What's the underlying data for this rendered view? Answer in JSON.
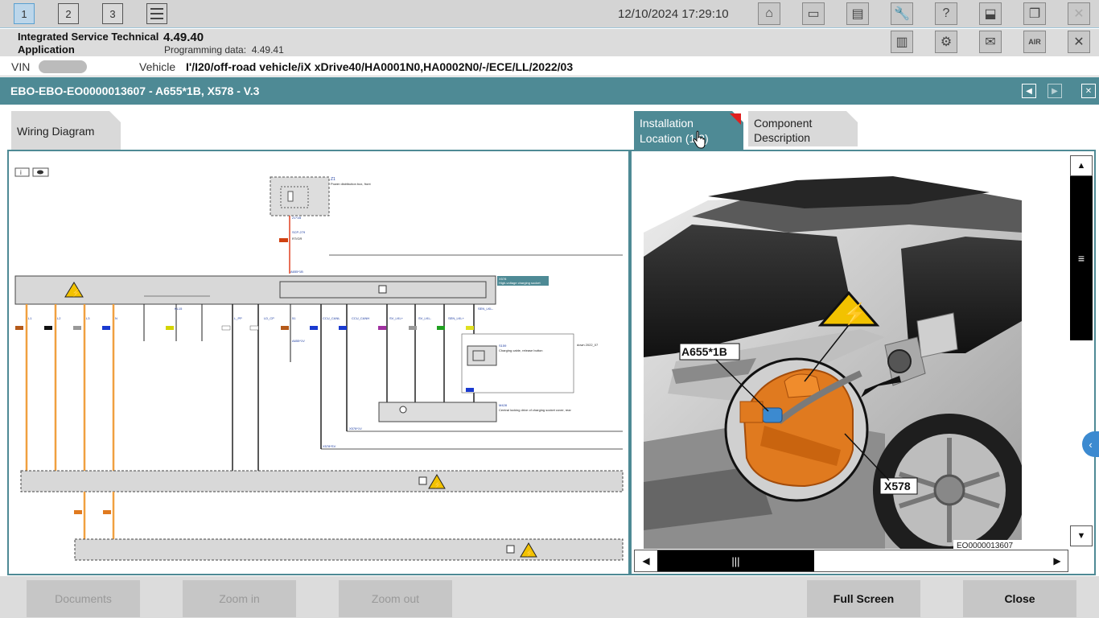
{
  "topbar": {
    "tabs": [
      "1",
      "2",
      "3"
    ],
    "datetime": "12/10/2024 17:29:10"
  },
  "app": {
    "name": "Integrated Service Technical Application",
    "version": "4.49.40",
    "programming_label": "Programming data:",
    "programming_version": "4.49.41"
  },
  "vehicle": {
    "vin_label": "VIN",
    "vin_value": "",
    "vehicle_label": "Vehicle",
    "vehicle_value": "I'/I20/off-road vehicle/iX xDrive40/HA0001N0,HA0002N0/-/ECE/LL/2022/03"
  },
  "document": {
    "title": "EBO-EBO-EO0000013607 - A655*1B, X578 - V.3"
  },
  "tabs": {
    "wiring": "Wiring Diagram",
    "installation": "Installation Location (1/3)",
    "component": "Component Description"
  },
  "diagram": {
    "z1": "Z1",
    "z1_desc": "Power distribution box, front",
    "x578": "X578",
    "x578_desc": "High-voltage charging socket",
    "s159": "S159",
    "s159_desc": "Charging cable, release button",
    "down": "down 2022_07",
    "m428": "M428",
    "m428_desc": "Central locking drive of charging socket cover, rear",
    "x578v": "X578*1V",
    "x578sv": "X578*SV",
    "a655": "A655*1B",
    "pins": [
      "L1",
      "L2",
      "L3",
      "N",
      "KL15",
      "L_PP",
      "LD_CP",
      "51",
      "CCU_CANL",
      "CCU_CANH",
      "SV_LKL+",
      "SV_LKL-",
      "SEN_LKL+",
      "SEN_LKL-"
    ]
  },
  "image": {
    "label_a655": "A655*1B",
    "label_x578": "X578",
    "code": "EO0000013607"
  },
  "buttons": {
    "documents": "Documents",
    "zoom_in": "Zoom in",
    "zoom_out": "Zoom out",
    "full_screen": "Full Screen",
    "close": "Close"
  },
  "colors": {
    "accent": "#4e8a95",
    "orange_wire": "#f0a040",
    "component_orange": "#e07a1f"
  }
}
